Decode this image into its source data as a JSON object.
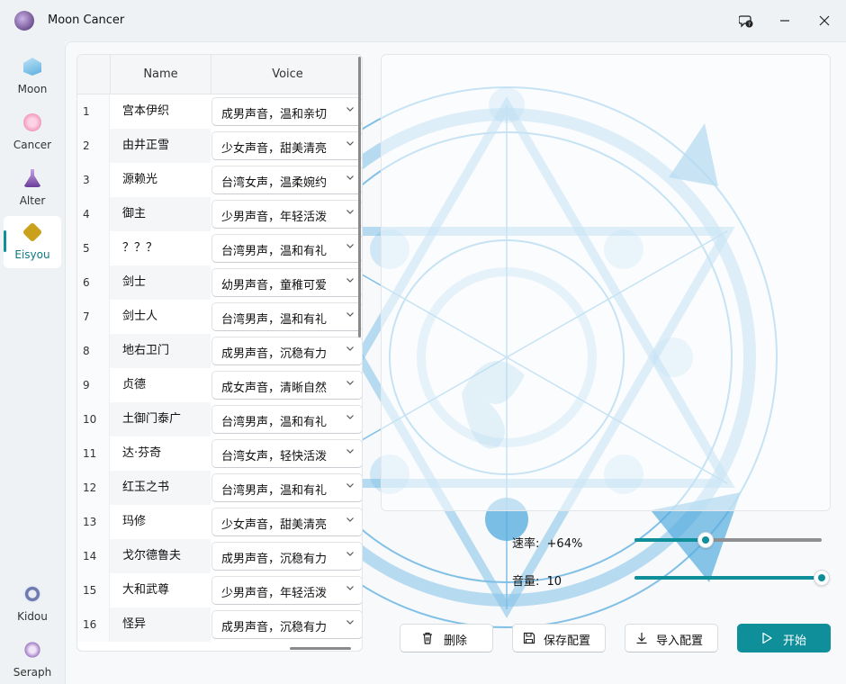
{
  "window": {
    "title": "Moon Cancer"
  },
  "sidebar": {
    "items": [
      {
        "label": "Moon",
        "icon": "moon-crystal-icon"
      },
      {
        "label": "Cancer",
        "icon": "sakura-icon"
      },
      {
        "label": "Alter",
        "icon": "potion-icon"
      },
      {
        "label": "Eisyou",
        "icon": "diamond-icon",
        "active": true
      }
    ],
    "bottom_items": [
      {
        "label": "Kidou",
        "icon": "rune-circle-icon"
      },
      {
        "label": "Seraph",
        "icon": "seraph-icon"
      }
    ]
  },
  "table": {
    "columns": [
      "",
      "Name",
      "Voice"
    ],
    "rows": [
      {
        "num": "1",
        "name": "宫本伊织",
        "voice": "成男声音，温和亲切"
      },
      {
        "num": "2",
        "name": "由井正雪",
        "voice": "少女声音，甜美清亮"
      },
      {
        "num": "3",
        "name": "源赖光",
        "voice": "台湾女声，温柔婉约"
      },
      {
        "num": "4",
        "name": "御主",
        "voice": "少男声音，年轻活泼"
      },
      {
        "num": "5",
        "name": "？？？",
        "voice": "台湾男声，温和有礼"
      },
      {
        "num": "6",
        "name": "剑士",
        "voice": "幼男声音，童稚可爱"
      },
      {
        "num": "7",
        "name": "剑士人",
        "voice": "台湾男声，温和有礼"
      },
      {
        "num": "8",
        "name": "地右卫门",
        "voice": "成男声音，沉稳有力"
      },
      {
        "num": "9",
        "name": "贞德",
        "voice": "成女声音，清晰自然"
      },
      {
        "num": "10",
        "name": "土御门泰广",
        "voice": "台湾男声，温和有礼"
      },
      {
        "num": "11",
        "name": "达·芬奇",
        "voice": "台湾女声，轻快活泼"
      },
      {
        "num": "12",
        "name": "红玉之书",
        "voice": "台湾男声，温和有礼"
      },
      {
        "num": "13",
        "name": "玛修",
        "voice": "少女声音，甜美清亮"
      },
      {
        "num": "14",
        "name": "戈尔德鲁夫",
        "voice": "成男声音，沉稳有力"
      },
      {
        "num": "15",
        "name": "大和武尊",
        "voice": "少男声音，年轻活泼"
      },
      {
        "num": "16",
        "name": "怪异",
        "voice": "成男声音，沉稳有力"
      }
    ]
  },
  "controls": {
    "rate": {
      "label": "速率:",
      "value_text": "+64%",
      "fraction": 0.38
    },
    "volume": {
      "label": "音量:",
      "value_text": "10",
      "fraction": 1.0
    }
  },
  "buttons": {
    "delete": "删除",
    "save": "保存配置",
    "import": "导入配置",
    "start": "开始"
  },
  "colors": {
    "accent": "#0e8f9a",
    "art": "#5aaee0"
  }
}
